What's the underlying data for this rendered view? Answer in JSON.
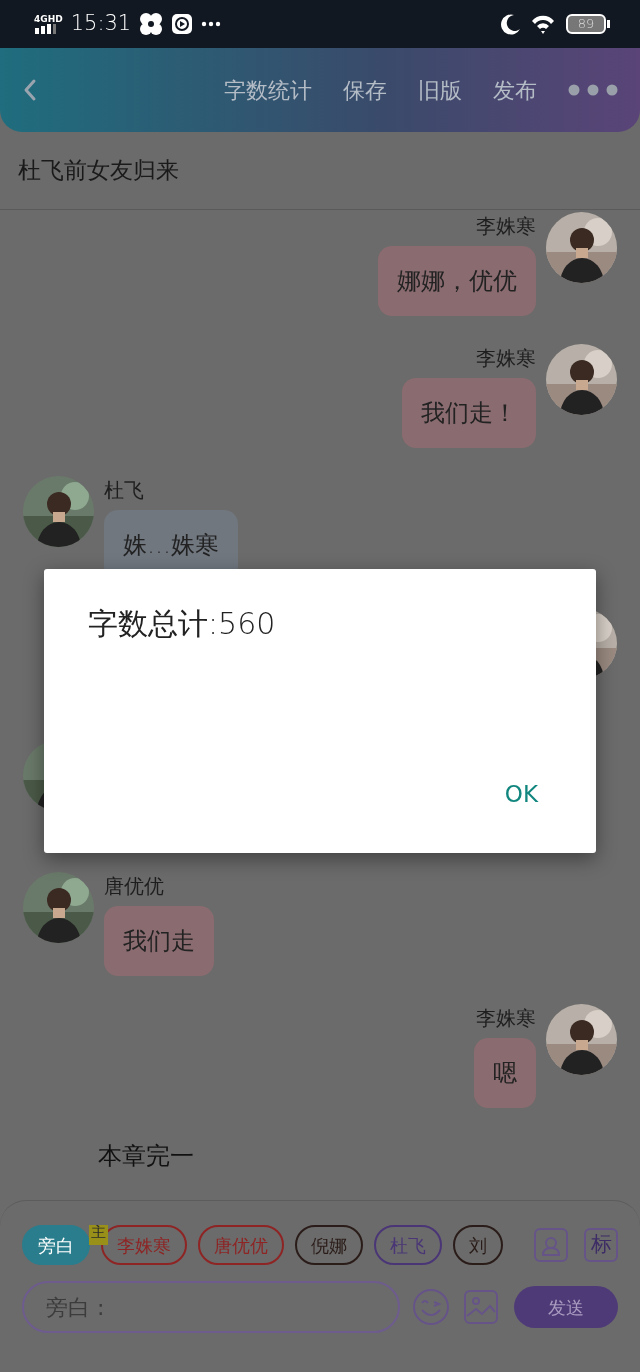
{
  "status_bar": {
    "network": "4GHD",
    "time": "15:31",
    "battery": "89"
  },
  "header": {
    "actions": [
      "字数统计",
      "保存",
      "旧版",
      "发布"
    ]
  },
  "title": "杜飞前女友归来",
  "messages": [
    {
      "kind": "right",
      "name": "李姝寒",
      "text": "娜娜，优优",
      "color": "#8a6b70"
    },
    {
      "kind": "right",
      "name": "李姝寒",
      "text": "我们走！",
      "color": "#8a6b70"
    },
    {
      "kind": "left",
      "name": "杜飞",
      "text": "姝…姝寒",
      "color": "#70777f"
    },
    {
      "kind": "right"
    },
    {
      "kind": "left"
    },
    {
      "kind": "left",
      "name": "唐优优",
      "text": "我们走",
      "color": "#8a6b70"
    },
    {
      "kind": "right",
      "name": "李姝寒",
      "text": "嗯",
      "color": "#8a6b70"
    },
    {
      "kind": "narration",
      "text": "本章完一"
    }
  ],
  "roles": [
    {
      "label": "旁白",
      "selected": true,
      "color": "#2a7d8c"
    },
    {
      "label": "李姝寒",
      "selected": false,
      "color": "#8e2424",
      "badge": "主"
    },
    {
      "label": "唐优优",
      "selected": false,
      "color": "#8e2424"
    },
    {
      "label": "倪娜",
      "selected": false,
      "color": "#2a1c18"
    },
    {
      "label": "杜飞",
      "selected": false,
      "color": "#4a3676"
    },
    {
      "label": "刘",
      "selected": false,
      "color": "#2a1c18"
    }
  ],
  "tag_button": "标",
  "input": {
    "placeholder": "旁白 :"
  },
  "send": "发送",
  "dialog": {
    "message": "字数总计:560",
    "button": "OK"
  }
}
